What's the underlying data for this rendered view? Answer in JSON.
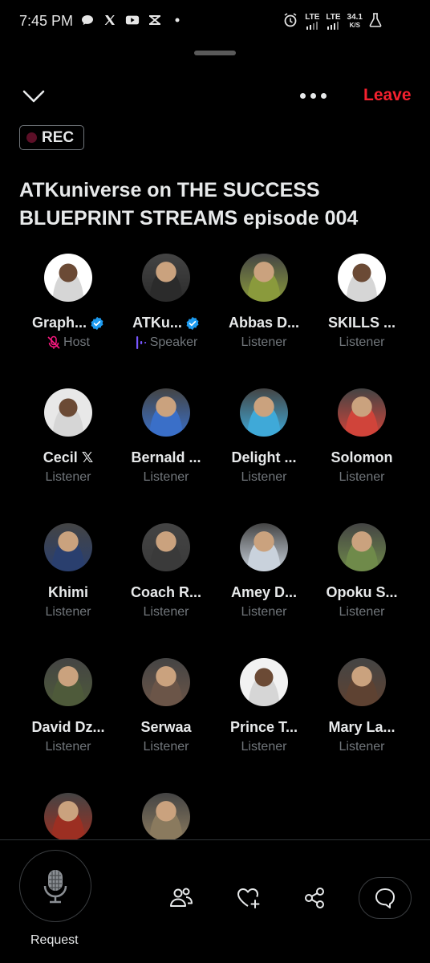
{
  "status_bar": {
    "time": "7:45 PM",
    "left_icons": [
      "chat-bubble-icon",
      "x-logo-icon",
      "youtube-icon",
      "capcut-icon",
      "dot-icon"
    ],
    "network_1": "LTE",
    "network_2": "LTE",
    "speed_value": "34.1",
    "speed_unit": "K/S"
  },
  "header": {
    "leave_label": "Leave",
    "rec_label": "REC"
  },
  "space": {
    "title": "ATKuniverse on THE SUCCESS BLUEPRINT STREAMS episode 004"
  },
  "participants": [
    {
      "name": "Graph...",
      "role": "Host",
      "verified": true,
      "role_icon": "muted-mic-icon",
      "color": "#ffffff"
    },
    {
      "name": "ATKu...",
      "role": "Speaker",
      "verified": true,
      "role_icon": "speaking-bars-icon",
      "color": "#2b2b2b"
    },
    {
      "name": "Abbas D...",
      "role": "Listener",
      "color": "#8a9a3c"
    },
    {
      "name": "SKILLS ...",
      "role": "Listener",
      "color": "#ffffff"
    },
    {
      "name": "Cecil 𝕏",
      "role": "Listener",
      "color": "#e8e8e8"
    },
    {
      "name": "Bernald ...",
      "role": "Listener",
      "color": "#3a6fc8"
    },
    {
      "name": "Delight ...",
      "role": "Listener",
      "color": "#3fa9d8"
    },
    {
      "name": "Solomon",
      "role": "Listener",
      "color": "#d0443a"
    },
    {
      "name": "Khimi",
      "role": "Listener",
      "color": "#2a3f6e"
    },
    {
      "name": "Coach R...",
      "role": "Listener",
      "color": "#3a3a3a"
    },
    {
      "name": "Amey D...",
      "role": "Listener",
      "color": "#c9d2dc"
    },
    {
      "name": "Opoku S...",
      "role": "Listener",
      "color": "#6f8a4a"
    },
    {
      "name": "David Dz...",
      "role": "Listener",
      "color": "#4e5a3a"
    },
    {
      "name": "Serwaa",
      "role": "Listener",
      "color": "#6b5548"
    },
    {
      "name": "Prince T...",
      "role": "Listener",
      "color": "#f2f2f2"
    },
    {
      "name": "Mary La...",
      "role": "Listener",
      "color": "#5e4232"
    },
    {
      "name": "",
      "role": "",
      "color": "#9c2f22"
    },
    {
      "name": "",
      "role": "",
      "color": "#8a7a5e"
    }
  ],
  "bottom_bar": {
    "request_label": "Request",
    "tools": [
      "people-icon",
      "heart-plus-icon",
      "share-icon",
      "chat-icon"
    ]
  },
  "colors": {
    "accent_leave": "#f4212e",
    "verified_blue": "#1d9bf0",
    "speaker_purple": "#7856ff",
    "muted_red": "#f91880",
    "secondary_text": "#71767b"
  }
}
